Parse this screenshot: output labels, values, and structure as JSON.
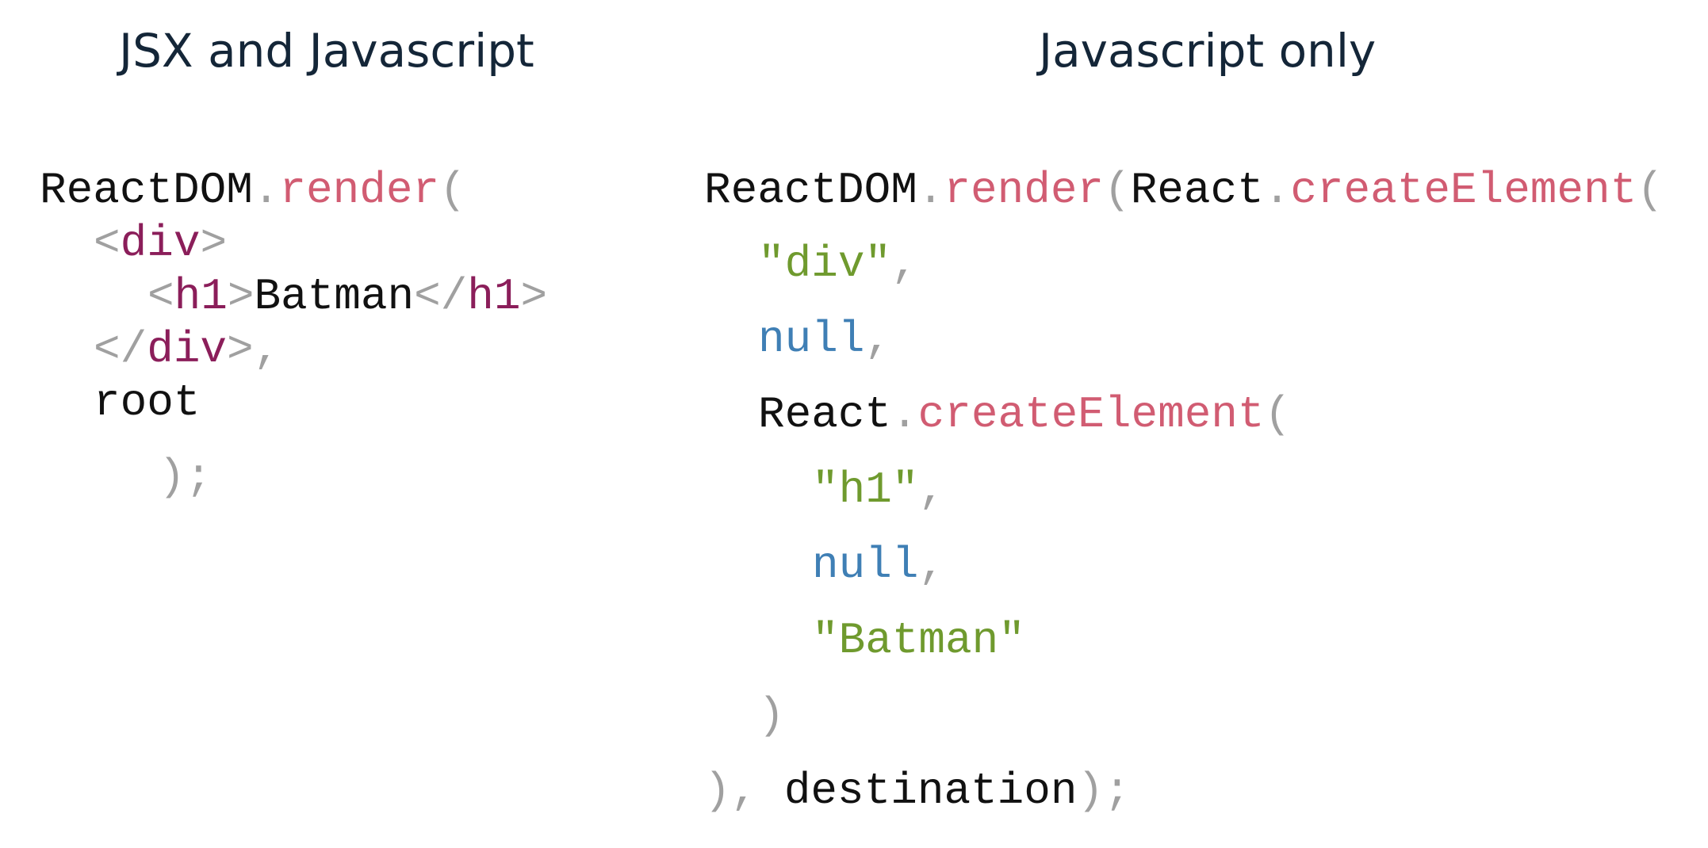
{
  "titles": {
    "left": "JSX and Javascript",
    "right": "Javascript only"
  },
  "colors": {
    "title": "#142638",
    "plain": "#111111",
    "punctuation": "#a0a0a0",
    "method": "#d15c72",
    "tag": "#8b1e5a",
    "string": "#6f9a2e",
    "null_keyword": "#3f7fb5"
  },
  "left_code": [
    {
      "tokens": [
        {
          "t": "ReactDOM",
          "k": "plain"
        },
        {
          "t": ".",
          "k": "punct"
        },
        {
          "t": "render",
          "k": "method"
        },
        {
          "t": "(",
          "k": "punct"
        }
      ]
    },
    {
      "tokens": [
        {
          "t": "<",
          "k": "punct"
        },
        {
          "t": "div",
          "k": "tag"
        },
        {
          "t": ">",
          "k": "punct"
        }
      ]
    },
    {
      "tokens": [
        {
          "t": "<",
          "k": "punct"
        },
        {
          "t": "h1",
          "k": "tag"
        },
        {
          "t": ">",
          "k": "punct"
        },
        {
          "t": "Batman",
          "k": "plain"
        },
        {
          "t": "</",
          "k": "punct"
        },
        {
          "t": "h1",
          "k": "tag"
        },
        {
          "t": ">",
          "k": "punct"
        }
      ]
    },
    {
      "tokens": [
        {
          "t": "</",
          "k": "punct"
        },
        {
          "t": "div",
          "k": "tag"
        },
        {
          "t": ">,",
          "k": "punct"
        }
      ]
    },
    {
      "tokens": [
        {
          "t": "root",
          "k": "plain"
        }
      ]
    },
    {
      "tokens": [
        {
          "t": ");",
          "k": "punct"
        }
      ]
    }
  ],
  "right_code": [
    {
      "tokens": [
        {
          "t": "ReactDOM",
          "k": "plain"
        },
        {
          "t": ".",
          "k": "punct"
        },
        {
          "t": "render",
          "k": "method"
        },
        {
          "t": "(",
          "k": "punct"
        },
        {
          "t": "React",
          "k": "plain"
        },
        {
          "t": ".",
          "k": "punct"
        },
        {
          "t": "createElement",
          "k": "method"
        },
        {
          "t": "(",
          "k": "punct"
        }
      ]
    },
    {
      "tokens": [
        {
          "t": "\"div\"",
          "k": "string"
        },
        {
          "t": ",",
          "k": "punct"
        }
      ]
    },
    {
      "tokens": [
        {
          "t": "null",
          "k": "null"
        },
        {
          "t": ",",
          "k": "punct"
        }
      ]
    },
    {
      "tokens": [
        {
          "t": "React",
          "k": "plain"
        },
        {
          "t": ".",
          "k": "punct"
        },
        {
          "t": "createElement",
          "k": "method"
        },
        {
          "t": "(",
          "k": "punct"
        }
      ]
    },
    {
      "tokens": [
        {
          "t": "\"h1\"",
          "k": "string"
        },
        {
          "t": ",",
          "k": "punct"
        }
      ]
    },
    {
      "tokens": [
        {
          "t": "null",
          "k": "null"
        },
        {
          "t": ",",
          "k": "punct"
        }
      ]
    },
    {
      "tokens": [
        {
          "t": "\"Batman\"",
          "k": "string"
        }
      ]
    },
    {
      "tokens": [
        {
          "t": ")",
          "k": "punct"
        }
      ]
    },
    {
      "tokens": [
        {
          "t": "), ",
          "k": "punct"
        },
        {
          "t": "destination",
          "k": "plain"
        },
        {
          "t": ");",
          "k": "punct"
        }
      ]
    }
  ]
}
